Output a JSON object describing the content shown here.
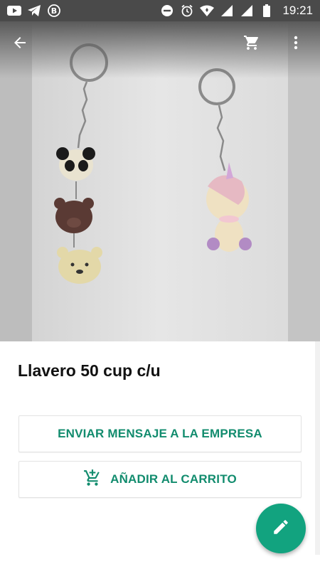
{
  "status_bar": {
    "time": "19:21",
    "left_icons": [
      "youtube-icon",
      "telegram-icon",
      "b-circle-icon"
    ],
    "right_icons": [
      "dnd-icon",
      "alarm-icon",
      "wifi-icon",
      "signal-icon",
      "signal-icon",
      "battery-icon"
    ]
  },
  "toolbar": {
    "back_icon": "arrow-back-icon",
    "cart_icon": "cart-icon",
    "menu_icon": "more-vert-icon"
  },
  "product": {
    "title": "Llavero 50 cup c/u"
  },
  "actions": {
    "message_label": "ENVIAR MENSAJE A LA EMPRESA",
    "cart_label": "AÑADIR AL CARRITO"
  },
  "colors": {
    "accent": "#128c6e",
    "fab": "#12a37f",
    "status_bar": "#4a4a4a"
  }
}
